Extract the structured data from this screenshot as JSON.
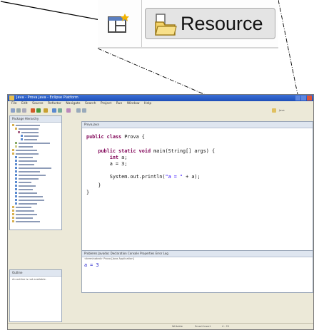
{
  "zoom": {
    "resource_label": "Resource",
    "open_perspective_icon": "open-perspective-icon",
    "resource_icon": "resource-perspective-icon"
  },
  "window": {
    "title": "Java - Prova.java - Eclipse Platform",
    "menu": [
      "File",
      "Edit",
      "Source",
      "Refactor",
      "Navigate",
      "Search",
      "Project",
      "Run",
      "Window",
      "Help"
    ],
    "package_tabs": "Package   Hierarchy",
    "editor_tab": "Prova.java",
    "perspective_label": "Java",
    "outline_tab": "Outline",
    "outline_text": "An outline is not available.",
    "bottom_tabs": "Problems   Javadoc   Declaration   Console   Properties   Error Log",
    "console_header": "<terminated> Prova [Java Application]",
    "console_output": "a = 3",
    "status": [
      "Writable",
      "Smart Insert",
      "4 : 21"
    ]
  },
  "code_lines": [
    "public class Prova {",
    "    public static void main(String[] args) {",
    "        int a;",
    "        a = 3;",
    "        System.out.println(\"a = \" + a);",
    "    }",
    "}"
  ]
}
